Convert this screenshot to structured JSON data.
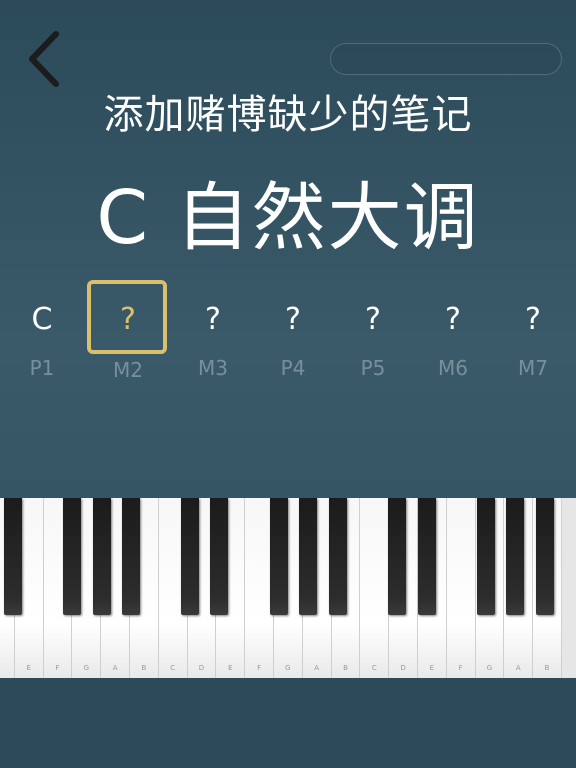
{
  "header": {
    "subtitle": "添加赌博缺少的笔记",
    "title": "C 自然大调"
  },
  "steps": [
    {
      "note": "C",
      "label": "P1",
      "active": false
    },
    {
      "note": "?",
      "label": "M2",
      "active": true
    },
    {
      "note": "?",
      "label": "M3",
      "active": false
    },
    {
      "note": "?",
      "label": "P4",
      "active": false
    },
    {
      "note": "?",
      "label": "P5",
      "active": false
    },
    {
      "note": "?",
      "label": "M6",
      "active": false
    },
    {
      "note": "?",
      "label": "M7",
      "active": false
    }
  ],
  "piano": {
    "white_keys": [
      "",
      "E",
      "F",
      "G",
      "A",
      "B",
      "C",
      "D",
      "E",
      "F",
      "G",
      "A",
      "B",
      "C",
      "D",
      "E",
      "F",
      "G",
      "A",
      "B"
    ]
  },
  "colors": {
    "accent": "#d9c06a",
    "background": "#35535f"
  },
  "icons": {
    "back": "chevron-left-icon"
  }
}
